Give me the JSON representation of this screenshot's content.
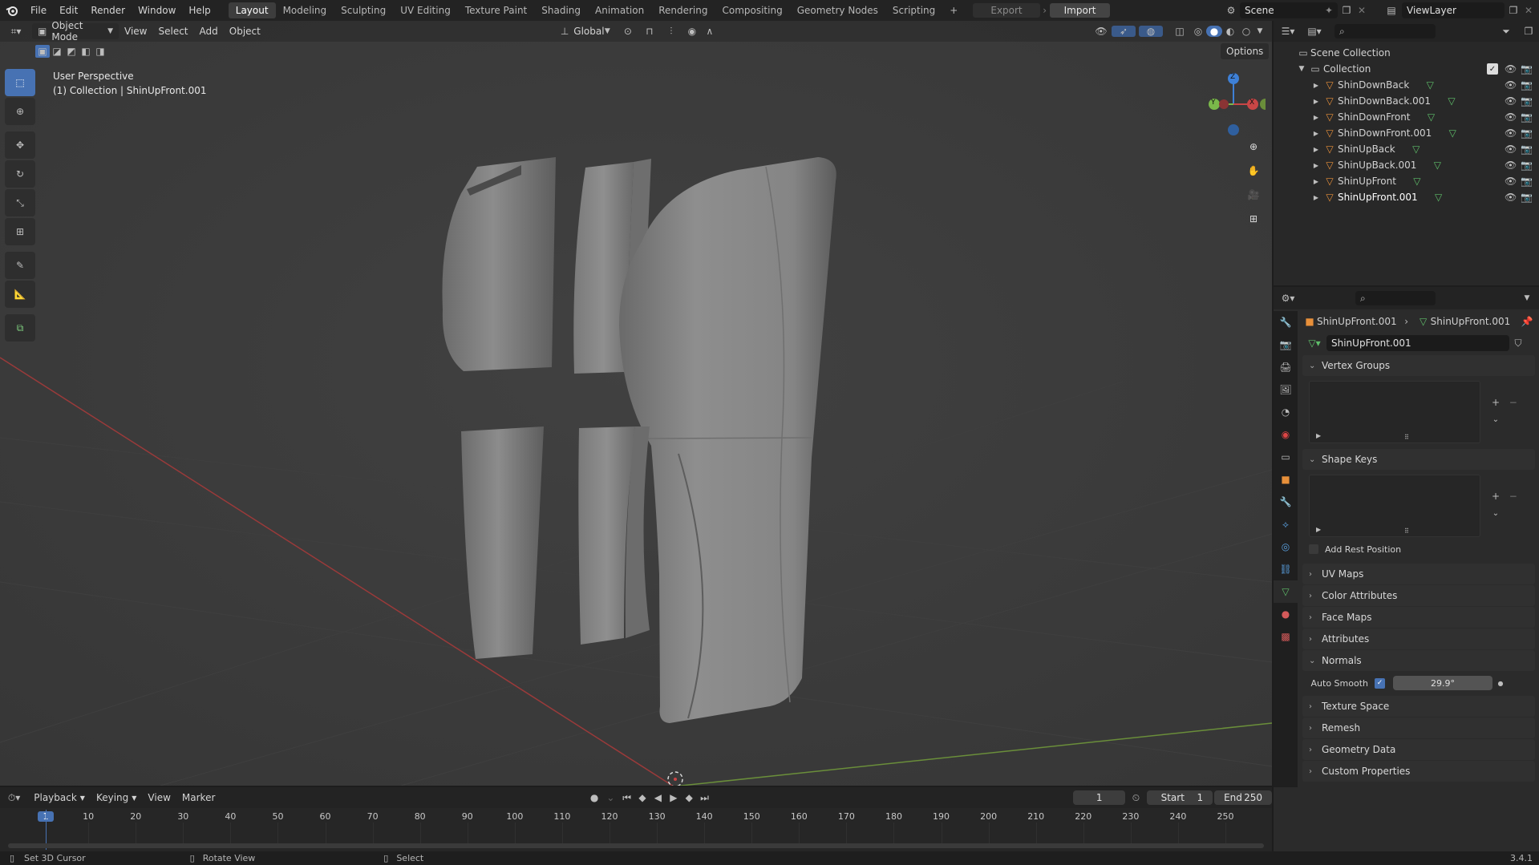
{
  "topbar": {
    "menus": [
      "File",
      "Edit",
      "Render",
      "Window",
      "Help"
    ],
    "workspaces": [
      "Layout",
      "Modeling",
      "Sculpting",
      "UV Editing",
      "Texture Paint",
      "Shading",
      "Animation",
      "Rendering",
      "Compositing",
      "Geometry Nodes",
      "Scripting"
    ],
    "active_workspace": "Layout",
    "add_tab": "+",
    "export_label": "Export",
    "import_label": "Import",
    "scene": "Scene",
    "view_layer": "ViewLayer"
  },
  "viewport": {
    "mode": "Object Mode",
    "menus": [
      "View",
      "Select",
      "Add",
      "Object"
    ],
    "orientation": "Global",
    "options": "Options",
    "overlay_title": "User Perspective",
    "overlay_sub": "(1) Collection | ShinUpFront.001",
    "gizmo": {
      "z": "Z",
      "y": "Y",
      "x": "X"
    }
  },
  "outliner": {
    "scene_collection": "Scene Collection",
    "collection": "Collection",
    "objects": [
      "ShinDownBack",
      "ShinDownBack.001",
      "ShinDownFront",
      "ShinDownFront.001",
      "ShinUpBack",
      "ShinUpBack.001",
      "ShinUpFront",
      "ShinUpFront.001"
    ],
    "selected": "ShinUpFront.001"
  },
  "properties": {
    "breadcrumb_object": "ShinUpFront.001",
    "breadcrumb_mesh": "ShinUpFront.001",
    "mesh_name": "ShinUpFront.001",
    "vertex_groups": "Vertex Groups",
    "shape_keys": "Shape Keys",
    "add_rest_position": "Add Rest Position",
    "uv_maps": "UV Maps",
    "color_attributes": "Color Attributes",
    "face_maps": "Face Maps",
    "attributes": "Attributes",
    "normals": "Normals",
    "auto_smooth": "Auto Smooth",
    "auto_smooth_angle": "29.9°",
    "texture_space": "Texture Space",
    "remesh": "Remesh",
    "geometry_data": "Geometry Data",
    "custom_properties": "Custom Properties"
  },
  "timeline": {
    "menus": [
      "Playback",
      "Keying",
      "View",
      "Marker"
    ],
    "current_frame": "1",
    "start_label": "Start",
    "start": "1",
    "end_label": "End",
    "end": "250",
    "ticks": [
      "1",
      "10",
      "20",
      "30",
      "40",
      "50",
      "60",
      "70",
      "80",
      "90",
      "100",
      "110",
      "120",
      "130",
      "140",
      "150",
      "160",
      "170",
      "180",
      "190",
      "200",
      "210",
      "220",
      "230",
      "240",
      "250"
    ]
  },
  "status": {
    "left": "Set 3D Cursor",
    "middle": "Rotate View",
    "right": "Select",
    "version": "3.4.1"
  },
  "colors": {
    "accent": "#4772b3",
    "object_orange": "#e8903a",
    "mesh_green": "#5fbf6a",
    "x_axis": "#c84646",
    "y_axis": "#7ab84a",
    "z_axis": "#3e80d6"
  }
}
